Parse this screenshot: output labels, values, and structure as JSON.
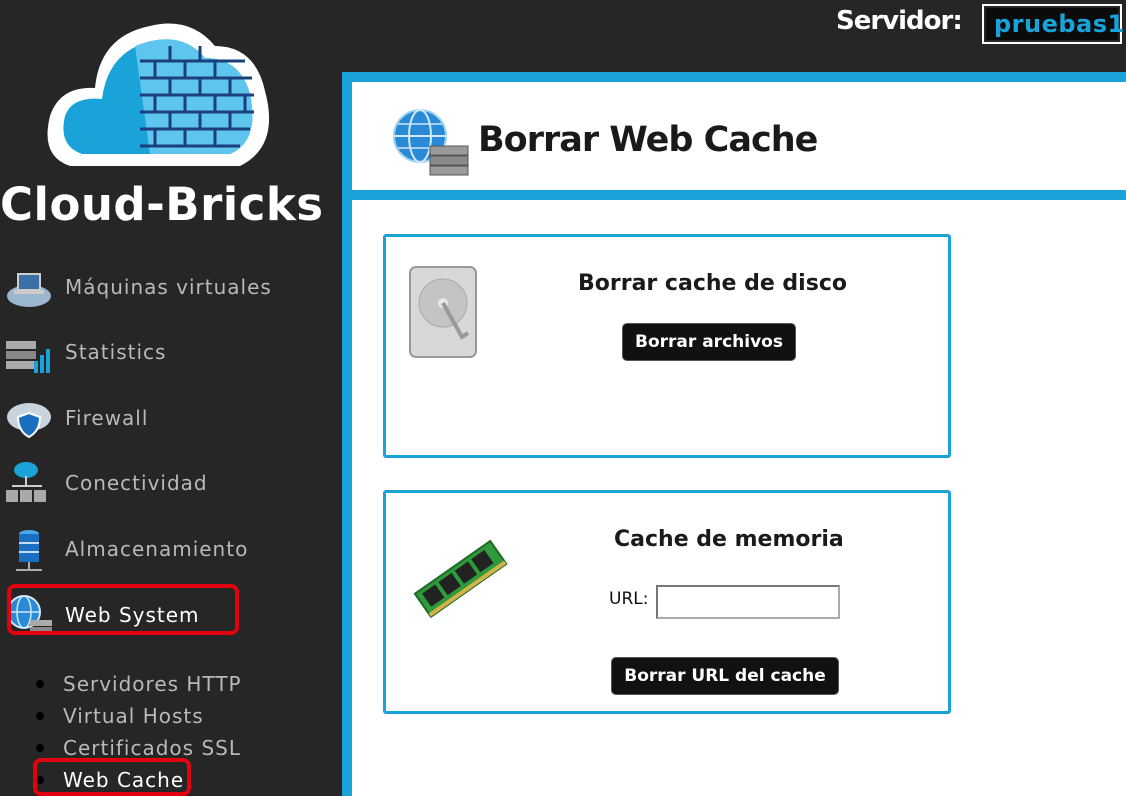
{
  "brand": {
    "name": "Cloud-Bricks"
  },
  "server": {
    "label": "Servidor:",
    "value": "pruebas1"
  },
  "sidebar": {
    "items": [
      {
        "label": "Máquinas virtuales",
        "icon": "virtual-machines-icon"
      },
      {
        "label": "Statistics",
        "icon": "statistics-icon"
      },
      {
        "label": "Firewall",
        "icon": "firewall-icon"
      },
      {
        "label": "Conectividad",
        "icon": "connectivity-icon"
      },
      {
        "label": "Almacenamiento",
        "icon": "storage-icon"
      },
      {
        "label": "Web System",
        "icon": "web-system-icon",
        "active": true
      }
    ],
    "subitems": [
      {
        "label": "Servidores HTTP"
      },
      {
        "label": "Virtual Hosts"
      },
      {
        "label": "Certificados SSL"
      },
      {
        "label": "Web Cache",
        "active": true
      }
    ]
  },
  "page": {
    "title": "Borrar Web Cache"
  },
  "disk_cache": {
    "title": "Borrar cache de disco",
    "button": "Borrar archivos"
  },
  "memory_cache": {
    "title": "Cache de memoria",
    "url_label": "URL:",
    "url_value": "",
    "button": "Borrar URL del cache"
  },
  "colors": {
    "accent": "#1aa3d8",
    "background": "#262626",
    "highlight": "#e3000f"
  }
}
